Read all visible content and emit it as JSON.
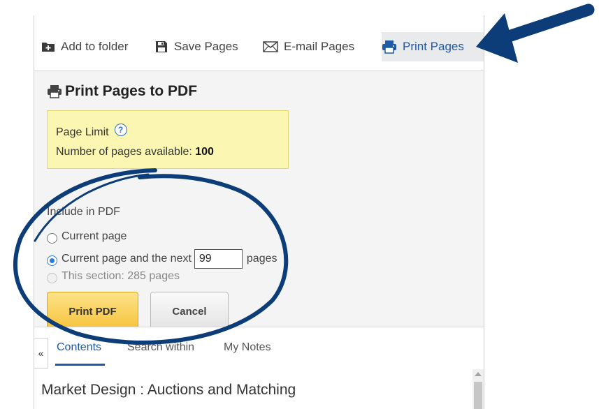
{
  "toolbar": {
    "add_to_folder": "Add to folder",
    "save_pages": "Save Pages",
    "email_pages": "E-mail Pages",
    "print_pages": "Print Pages"
  },
  "print_form": {
    "title": "Print Pages to PDF",
    "page_limit": {
      "label": "Page Limit",
      "help": "?",
      "available_text": "Number of pages available:",
      "available_count": "100"
    },
    "include_label": "Include in PDF",
    "options": {
      "current_page": "Current page",
      "current_and_next_prefix": "Current page and the next",
      "next_pages_value": "99",
      "current_and_next_suffix": "pages",
      "this_section": "This section: 285 pages"
    },
    "selected_option": "current_and_next",
    "print_button": "Print PDF",
    "cancel_button": "Cancel"
  },
  "bottom_panel": {
    "collapse": "«",
    "tabs": [
      "Contents",
      "Search within",
      "My Notes"
    ],
    "active_tab": "Contents",
    "book_title": "Market Design : Auctions and Matching"
  },
  "colors": {
    "accent_blue": "#1f5aa6",
    "annotation_navy": "#0d3d78",
    "page_limit_bg": "#fbf7b3",
    "print_button": "#f6c239"
  }
}
